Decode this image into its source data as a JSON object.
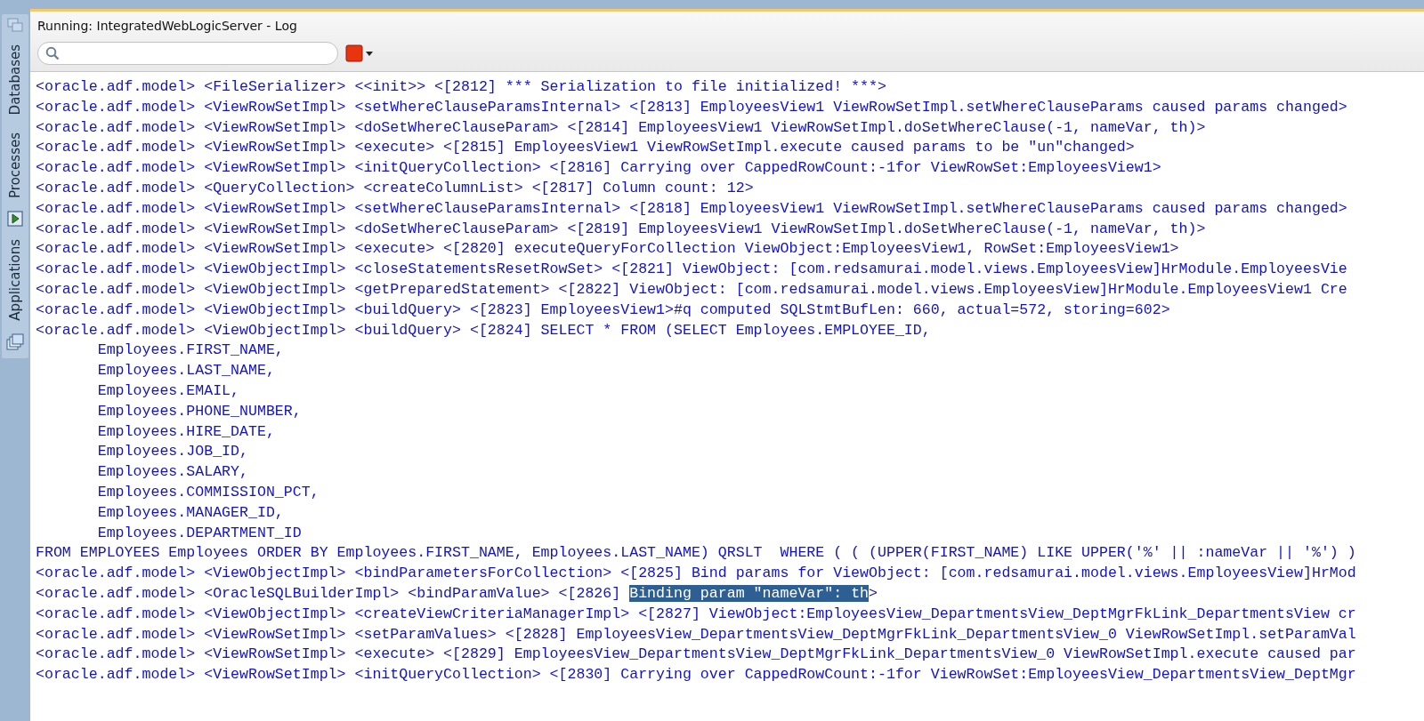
{
  "sidebar": {
    "tabs": [
      {
        "label": "Databases",
        "kind": "plain"
      },
      {
        "label": "Processes",
        "kind": "play"
      },
      {
        "label": "Applications",
        "kind": "windows"
      }
    ]
  },
  "window": {
    "title": "Running: IntegratedWebLogicServer - Log"
  },
  "log": {
    "lines": [
      {
        "kind": "normal",
        "text": "<oracle.adf.model> <FileSerializer> <<init>> <[2812] *** Serialization to file initialized! ***>"
      },
      {
        "kind": "normal",
        "text": "<oracle.adf.model> <ViewRowSetImpl> <setWhereClauseParamsInternal> <[2813] EmployeesView1 ViewRowSetImpl.setWhereClauseParams caused params changed>"
      },
      {
        "kind": "normal",
        "text": "<oracle.adf.model> <ViewRowSetImpl> <doSetWhereClauseParam> <[2814] EmployeesView1 ViewRowSetImpl.doSetWhereClause(-1, nameVar, th)>"
      },
      {
        "kind": "normal",
        "text": "<oracle.adf.model> <ViewRowSetImpl> <execute> <[2815] EmployeesView1 ViewRowSetImpl.execute caused params to be \"un\"changed>"
      },
      {
        "kind": "normal",
        "text": "<oracle.adf.model> <ViewRowSetImpl> <initQueryCollection> <[2816] Carrying over CappedRowCount:-1for ViewRowSet:EmployeesView1>"
      },
      {
        "kind": "normal",
        "text": "<oracle.adf.model> <QueryCollection> <createColumnList> <[2817] Column count: 12>"
      },
      {
        "kind": "normal",
        "text": "<oracle.adf.model> <ViewRowSetImpl> <setWhereClauseParamsInternal> <[2818] EmployeesView1 ViewRowSetImpl.setWhereClauseParams caused params changed>"
      },
      {
        "kind": "normal",
        "text": "<oracle.adf.model> <ViewRowSetImpl> <doSetWhereClauseParam> <[2819] EmployeesView1 ViewRowSetImpl.doSetWhereClause(-1, nameVar, th)>"
      },
      {
        "kind": "normal",
        "text": "<oracle.adf.model> <ViewRowSetImpl> <execute> <[2820] executeQueryForCollection ViewObject:EmployeesView1, RowSet:EmployeesView1>"
      },
      {
        "kind": "normal",
        "text": "<oracle.adf.model> <ViewObjectImpl> <closeStatementsResetRowSet> <[2821] ViewObject: [com.redsamurai.model.views.EmployeesView]HrModule.EmployeesVie"
      },
      {
        "kind": "normal",
        "text": "<oracle.adf.model> <ViewObjectImpl> <getPreparedStatement> <[2822] ViewObject: [com.redsamurai.model.views.EmployeesView]HrModule.EmployeesView1 Cre"
      },
      {
        "kind": "normal",
        "text": "<oracle.adf.model> <ViewObjectImpl> <buildQuery> <[2823] EmployeesView1>#q computed SQLStmtBufLen: 660, actual=572, storing=602>"
      },
      {
        "kind": "normal",
        "text": "<oracle.adf.model> <ViewObjectImpl> <buildQuery> <[2824] SELECT * FROM (SELECT Employees.EMPLOYEE_ID,"
      },
      {
        "kind": "indented",
        "text": "Employees.FIRST_NAME,"
      },
      {
        "kind": "indented",
        "text": "Employees.LAST_NAME,"
      },
      {
        "kind": "indented",
        "text": "Employees.EMAIL,"
      },
      {
        "kind": "indented",
        "text": "Employees.PHONE_NUMBER,"
      },
      {
        "kind": "indented",
        "text": "Employees.HIRE_DATE,"
      },
      {
        "kind": "indented",
        "text": "Employees.JOB_ID,"
      },
      {
        "kind": "indented",
        "text": "Employees.SALARY,"
      },
      {
        "kind": "indented",
        "text": "Employees.COMMISSION_PCT,"
      },
      {
        "kind": "indented",
        "text": "Employees.MANAGER_ID,"
      },
      {
        "kind": "indented",
        "text": "Employees.DEPARTMENT_ID"
      },
      {
        "kind": "normal",
        "text": "FROM EMPLOYEES Employees ORDER BY Employees.FIRST_NAME, Employees.LAST_NAME) QRSLT  WHERE ( ( (UPPER(FIRST_NAME) LIKE UPPER('%' || :nameVar || '%') )"
      },
      {
        "kind": "normal",
        "text": "<oracle.adf.model> <ViewObjectImpl> <bindParametersForCollection> <[2825] Bind params for ViewObject: [com.redsamurai.model.views.EmployeesView]HrMod"
      },
      {
        "kind": "parts",
        "parts": [
          {
            "text": "<oracle.adf.model> <OracleSQLBuilderImpl> <bindParamValue> <[2826] ",
            "selected": false
          },
          {
            "text": "Binding param \"nameVar\": th",
            "selected": true
          },
          {
            "text": ">",
            "selected": false
          }
        ]
      },
      {
        "kind": "normal",
        "text": "<oracle.adf.model> <ViewObjectImpl> <createViewCriteriaManagerImpl> <[2827] ViewObject:EmployeesView_DepartmentsView_DeptMgrFkLink_DepartmentsView cr"
      },
      {
        "kind": "normal",
        "text": "<oracle.adf.model> <ViewRowSetImpl> <setParamValues> <[2828] EmployeesView_DepartmentsView_DeptMgrFkLink_DepartmentsView_0 ViewRowSetImpl.setParamVal"
      },
      {
        "kind": "normal",
        "text": "<oracle.adf.model> <ViewRowSetImpl> <execute> <[2829] EmployeesView_DepartmentsView_DeptMgrFkLink_DepartmentsView_0 ViewRowSetImpl.execute caused par"
      },
      {
        "kind": "normal",
        "text": "<oracle.adf.model> <ViewRowSetImpl> <initQueryCollection> <[2830] Carrying over CappedRowCount:-1for ViewRowSet:EmployeesView_DepartmentsView_DeptMgr"
      }
    ]
  }
}
